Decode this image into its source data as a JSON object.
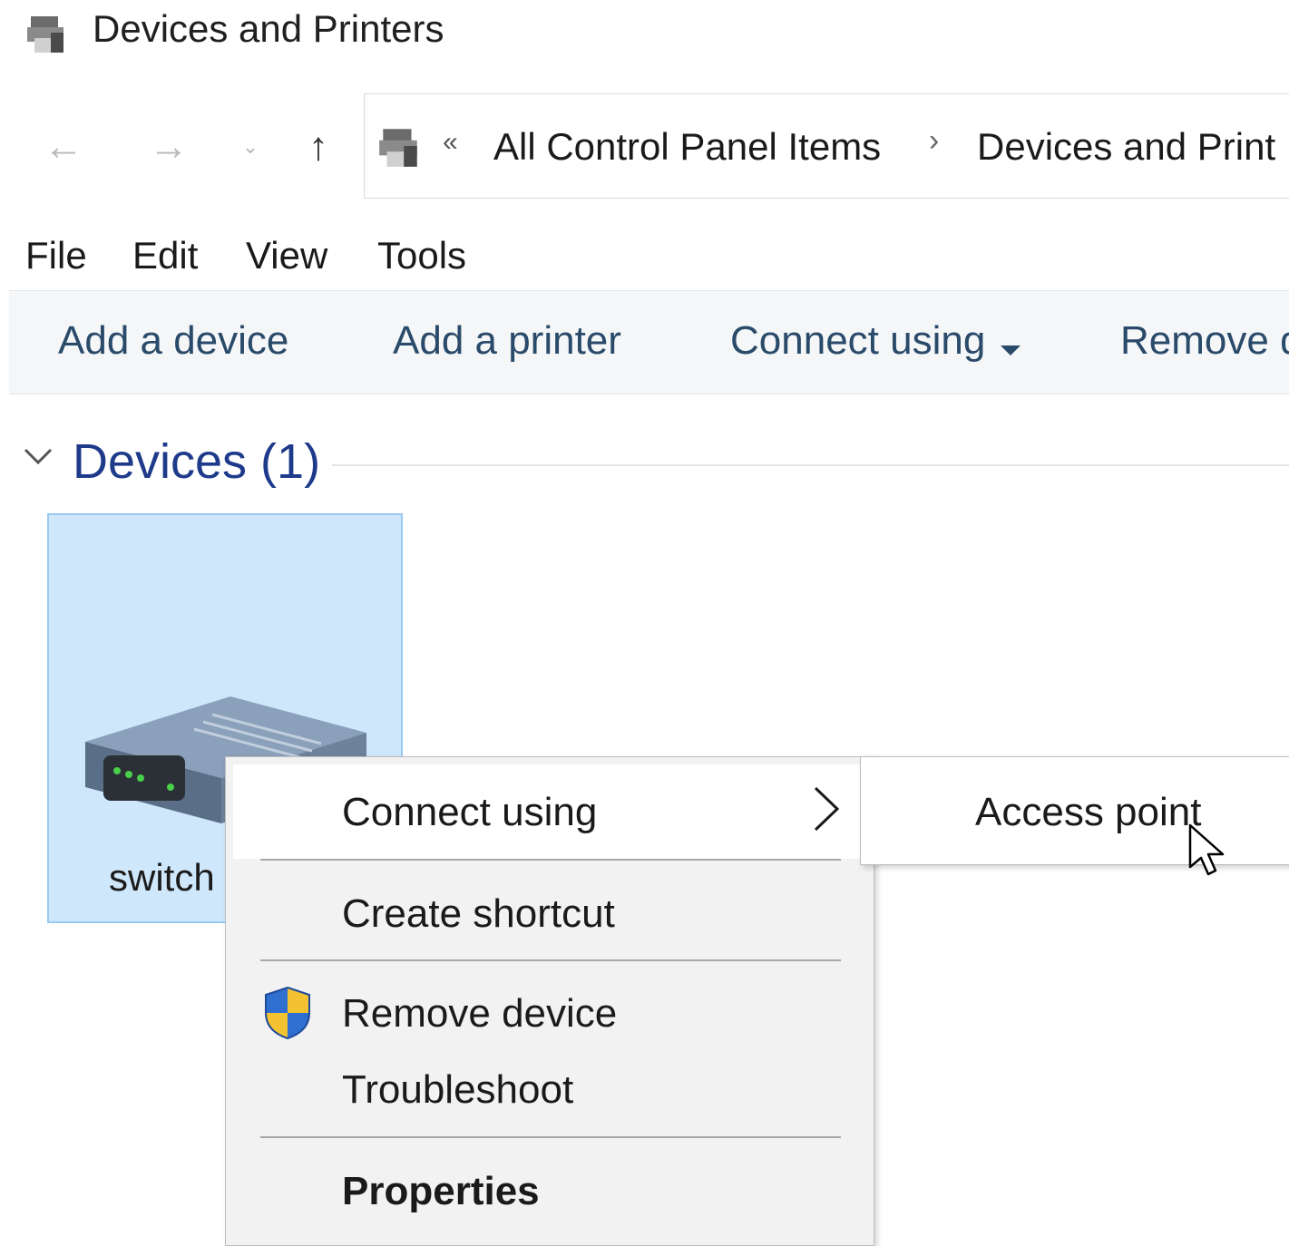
{
  "window": {
    "title": "Devices and Printers",
    "icon": "devices-printers-icon"
  },
  "nav": {
    "back_icon": "←",
    "forward_icon": "→",
    "recent_icon": "⌄",
    "up_icon": "↑"
  },
  "address": {
    "overflow": "«",
    "crumbs": [
      "All Control Panel Items",
      "Devices and Print"
    ],
    "separator": "›"
  },
  "menubar": [
    "File",
    "Edit",
    "View",
    "Tools"
  ],
  "commandbar": {
    "add_device": "Add a device",
    "add_printer": "Add a printer",
    "connect_using": "Connect using",
    "remove": "Remove d"
  },
  "group": {
    "title": "Devices (1)"
  },
  "device": {
    "label": "switch"
  },
  "context_menu": {
    "connect_using": "Connect using",
    "create_shortcut": "Create shortcut",
    "remove_device": "Remove device",
    "troubleshoot": "Troubleshoot",
    "properties": "Properties"
  },
  "submenu": {
    "access_point": "Access point"
  },
  "colors": {
    "selection": "#cfe7fb",
    "selection_border": "#99c9f3",
    "group_title": "#1e3a8a",
    "command_text": "#2a4a6a",
    "menu_bg": "#f2f2f2"
  }
}
